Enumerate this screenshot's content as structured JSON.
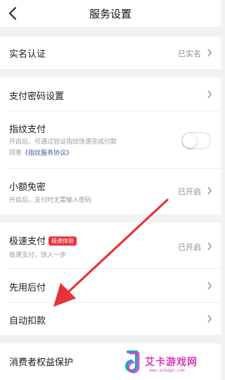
{
  "nav": {
    "title": "服务设置"
  },
  "realname": {
    "label": "实名认证",
    "status": "已实名"
  },
  "pay_password": {
    "label": "支付密码设置"
  },
  "fingerprint": {
    "label": "指纹支付",
    "desc": "开启后，可通过验证指纹快速完成付款",
    "agree_prefix": "同意",
    "agreement_link": "《指纹服务协议》",
    "enabled": false
  },
  "small_free": {
    "label": "小额免密",
    "desc": "开启后，支付时无需输入密码",
    "status": "已开启"
  },
  "fast_pay": {
    "label": "极速支付",
    "badge": "极速体验",
    "desc": "极速支付，快人一步",
    "status": "已开启"
  },
  "pay_later": {
    "label": "先用后付"
  },
  "auto_debit": {
    "label": "自动扣款"
  },
  "consumer": {
    "label": "消费者权益保护"
  },
  "watermark": {
    "text": "艾卡游戏网",
    "url": "www.aikago.com"
  },
  "colors": {
    "badge_bg": "#e8323a",
    "link": "#3b5b9c",
    "arrow": "#e8323a",
    "watermark": "#d63bb8"
  },
  "icons": {
    "back": "chevron-left-icon",
    "row_arrow": "chevron-right-icon"
  }
}
